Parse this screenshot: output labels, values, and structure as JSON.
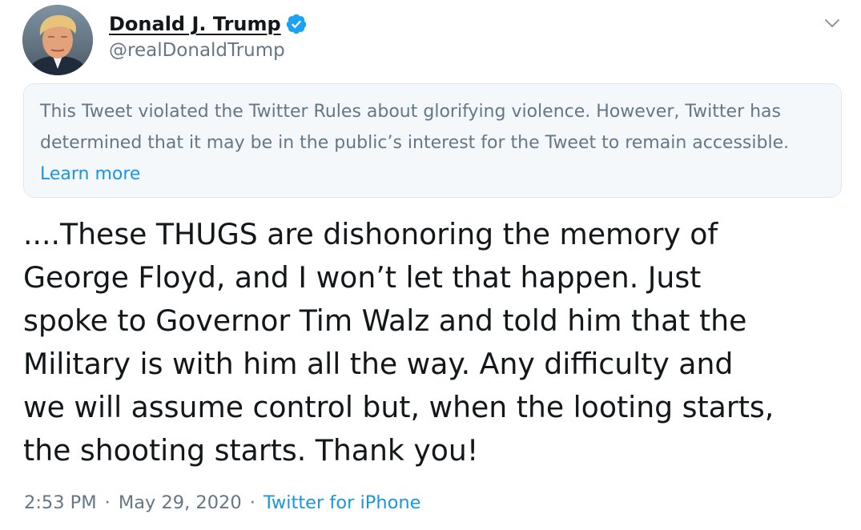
{
  "author": {
    "display_name": "Donald J. Trump",
    "handle": "@realDonaldTrump",
    "verified_icon": "verified-badge-icon",
    "avatar_icon": "profile-photo"
  },
  "menu": {
    "caret_icon": "chevron-down-icon"
  },
  "notice": {
    "text": "This Tweet violated the Twitter Rules about glorifying violence. However, Twitter has determined that it may be in the public’s interest for the Tweet to remain accessible. ",
    "link_label": "Learn more"
  },
  "tweet": {
    "lines": [
      "....These THUGS are dishonoring the memory of",
      "George Floyd, and I won’t let that happen. Just",
      "spoke to Governor Tim Walz and told him that the",
      "Military is with him all the way. Any difficulty and",
      "we will assume control but, when the looting starts,",
      "the shooting starts. Thank you!"
    ]
  },
  "meta": {
    "time": "2:53 PM",
    "separator": "·",
    "date": "May 29, 2020",
    "source": "Twitter for iPhone"
  },
  "colors": {
    "text": "#14171a",
    "secondary": "#657786",
    "link": "#1b95e0",
    "verified": "#1da1f2",
    "notice_bg": "#f5f8fa",
    "notice_border": "#e1e8ed"
  }
}
